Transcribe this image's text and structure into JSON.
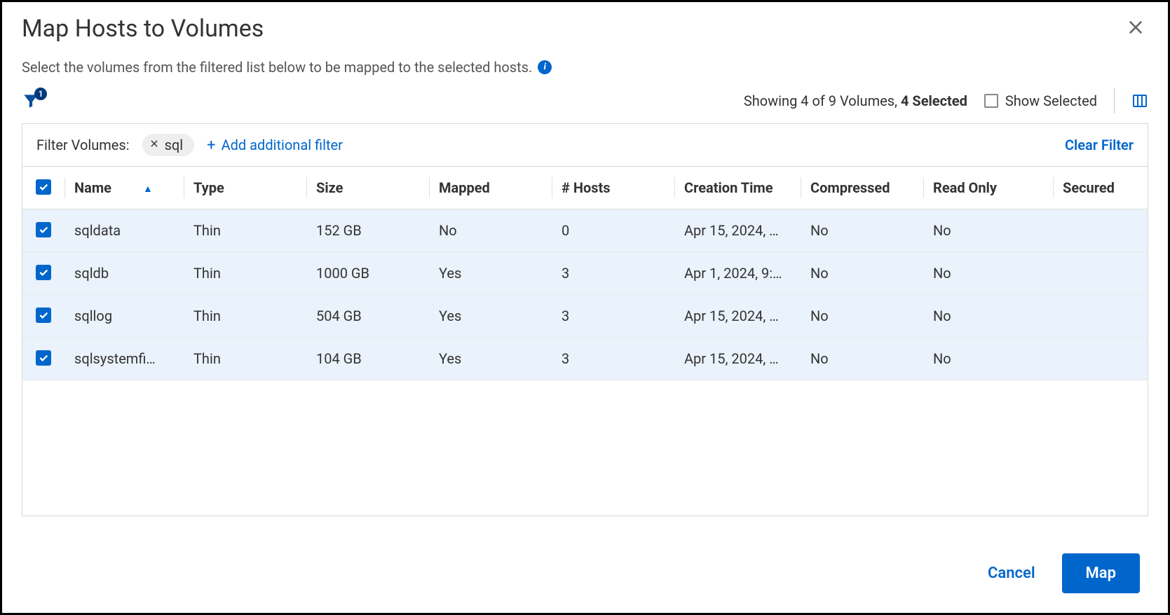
{
  "dialog": {
    "title": "Map Hosts to Volumes",
    "subtitle": "Select the volumes from the filtered list below to be mapped to the selected hosts."
  },
  "toolbar": {
    "filter_badge": "1",
    "showing_prefix": "Showing ",
    "showing_count": "4 of 9 Volumes, ",
    "selected_text": "4 Selected",
    "show_selected_label": "Show Selected"
  },
  "filter": {
    "label": "Filter Volumes:",
    "chip_value": "sql",
    "add_label": "Add additional filter",
    "clear_label": "Clear Filter"
  },
  "table": {
    "headers": {
      "name": "Name",
      "type": "Type",
      "size": "Size",
      "mapped": "Mapped",
      "hosts": "# Hosts",
      "creation": "Creation Time",
      "compressed": "Compressed",
      "readonly": "Read Only",
      "secured": "Secured"
    },
    "rows": [
      {
        "name": "sqldata",
        "type": "Thin",
        "size": "152 GB",
        "mapped": "No",
        "hosts": "0",
        "creation": "Apr 15, 2024, …",
        "compressed": "No",
        "readonly": "No",
        "secured": ""
      },
      {
        "name": "sqldb",
        "type": "Thin",
        "size": "1000 GB",
        "mapped": "Yes",
        "hosts": "3",
        "creation": "Apr 1, 2024, 9:…",
        "compressed": "No",
        "readonly": "No",
        "secured": ""
      },
      {
        "name": "sqllog",
        "type": "Thin",
        "size": "504 GB",
        "mapped": "Yes",
        "hosts": "3",
        "creation": "Apr 15, 2024, …",
        "compressed": "No",
        "readonly": "No",
        "secured": ""
      },
      {
        "name": "sqlsystemfi…",
        "type": "Thin",
        "size": "104 GB",
        "mapped": "Yes",
        "hosts": "3",
        "creation": "Apr 15, 2024, …",
        "compressed": "No",
        "readonly": "No",
        "secured": ""
      }
    ]
  },
  "footer": {
    "cancel": "Cancel",
    "map": "Map"
  },
  "colors": {
    "primary": "#0066cc"
  }
}
